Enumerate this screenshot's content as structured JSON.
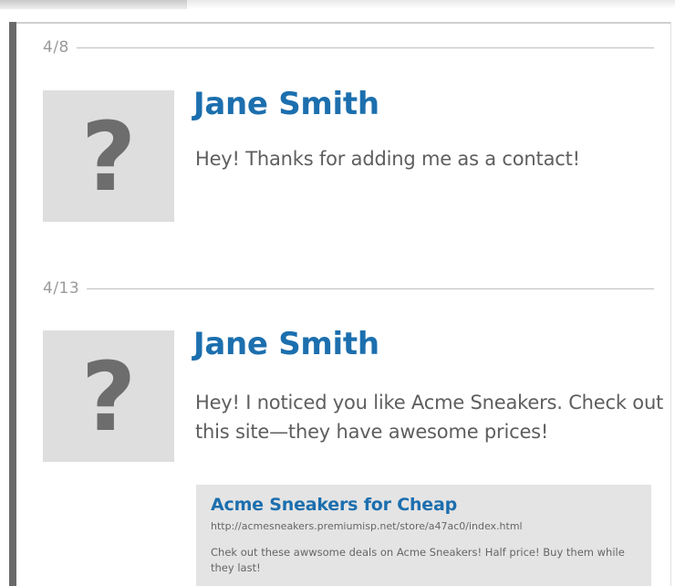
{
  "messages": [
    {
      "date": "4/8",
      "avatar_icon": "unknown-contact-question-mark",
      "avatar_glyph": "?",
      "sender": "Jane Smith",
      "text": "Hey! Thanks for adding me as a contact!"
    },
    {
      "date": "4/13",
      "avatar_icon": "unknown-contact-question-mark",
      "avatar_glyph": "?",
      "sender": "Jane Smith",
      "text": "Hey! I noticed you like Acme Sneakers. Check out this site—they have awesome prices!",
      "link_preview": {
        "title": "Acme Sneakers for Cheap",
        "url": "http://acmesneakers.premiumisp.net/store/a47ac0/index.html",
        "description": "Chek out these awwsome deals on Acme Sneakers! Half price! Buy them while they last!"
      }
    }
  ],
  "colors": {
    "accent": "#1c6fae",
    "text": "#5e5e5e",
    "date": "#9a9a9a",
    "avatar_bg": "#dedede",
    "card_bg": "#e4e4e4"
  }
}
